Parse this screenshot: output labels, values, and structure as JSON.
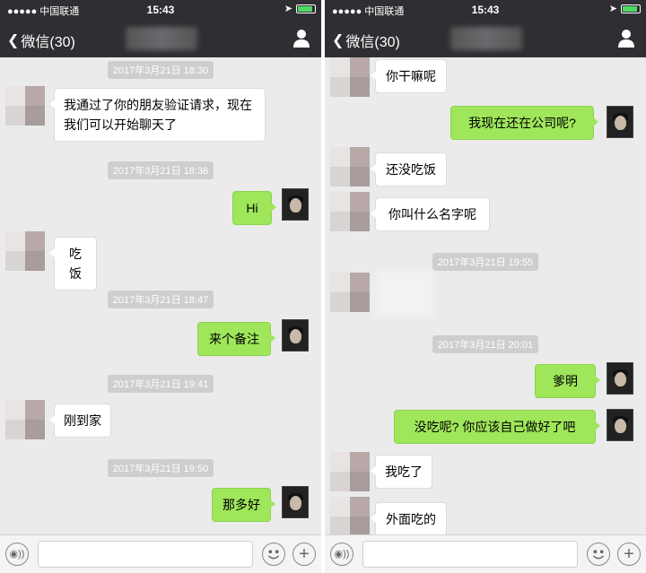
{
  "left": {
    "status": {
      "carrier": "●●●●● 中国联通",
      "time": "15:43"
    },
    "nav": {
      "back_label": "微信(30)"
    },
    "messages": [
      {
        "kind": "ts",
        "text": "2017年3月21日 18:30"
      },
      {
        "kind": "in",
        "text": "我通过了你的朋友验证请求，现在我们可以开始聊天了"
      },
      {
        "kind": "ts",
        "text": "2017年3月21日 18:36"
      },
      {
        "kind": "out",
        "text": "Hi"
      },
      {
        "kind": "in",
        "text": "吃饭"
      },
      {
        "kind": "ts",
        "text": "2017年3月21日 18:47"
      },
      {
        "kind": "out",
        "text": "来个备注"
      },
      {
        "kind": "ts",
        "text": "2017年3月21日 19:41"
      },
      {
        "kind": "in",
        "text": "刚到家"
      },
      {
        "kind": "ts",
        "text": "2017年3月21日 19:50"
      },
      {
        "kind": "out",
        "text": "那多好"
      }
    ]
  },
  "right": {
    "status": {
      "carrier": "●●●●● 中国联通",
      "time": "15:43"
    },
    "nav": {
      "back_label": "微信(30)"
    },
    "messages": [
      {
        "kind": "in",
        "text": "你干嘛呢"
      },
      {
        "kind": "out",
        "text": "我现在还在公司呢?"
      },
      {
        "kind": "in",
        "text": "还没吃饭"
      },
      {
        "kind": "in",
        "text": "你叫什么名字呢"
      },
      {
        "kind": "ts",
        "text": "2017年3月21日 19:55"
      },
      {
        "kind": "ts",
        "text": "2017年3月21日 20:01"
      },
      {
        "kind": "out",
        "text": "爹明"
      },
      {
        "kind": "out",
        "text": "没吃呢? 你应该自己做好了吧"
      },
      {
        "kind": "in",
        "text": "我吃了"
      },
      {
        "kind": "in",
        "text": "外面吃的"
      }
    ]
  },
  "colors": {
    "bar": "#2f2f33",
    "chat_bg": "#ebebeb",
    "bubble_out": "#9fe65a",
    "bubble_in": "#ffffff",
    "timestamp_bg": "#cecece"
  },
  "icons": [
    "back-chevron-icon",
    "wifi-icon",
    "battery-icon",
    "location-icon",
    "user-profile-icon",
    "voice-icon",
    "emoji-icon",
    "plus-icon"
  ]
}
